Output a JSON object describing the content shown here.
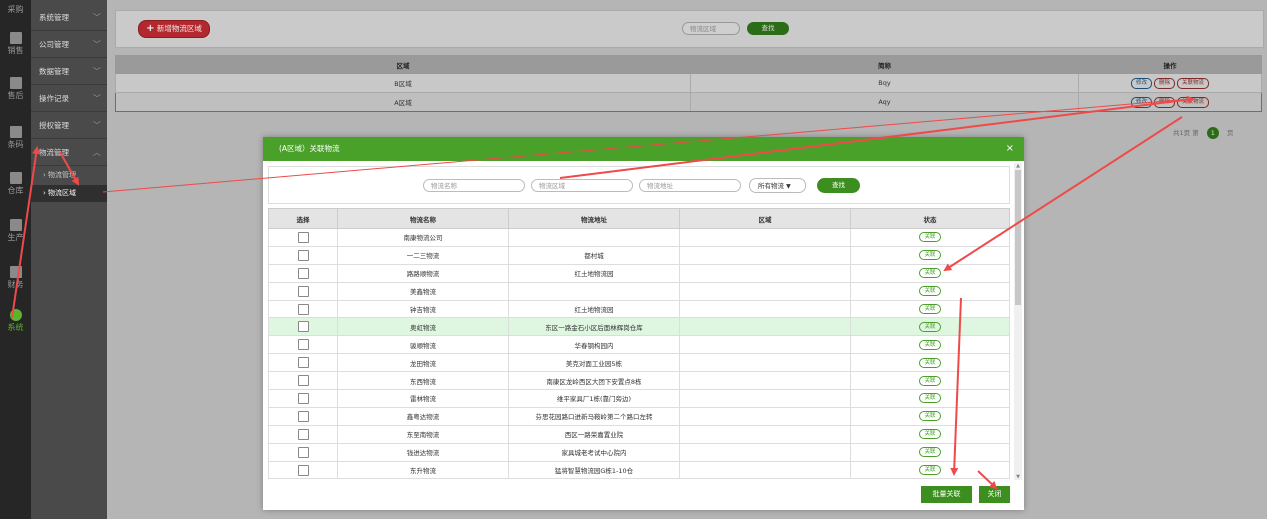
{
  "iconbar": {
    "items": [
      {
        "label": "采购",
        "icon": "purchase-icon"
      },
      {
        "label": "销售",
        "icon": "sales-icon"
      },
      {
        "label": "售后",
        "icon": "aftersale-icon"
      },
      {
        "label": "条码",
        "icon": "barcode-icon"
      },
      {
        "label": "仓库",
        "icon": "warehouse-icon"
      },
      {
        "label": "生产",
        "icon": "production-icon"
      },
      {
        "label": "财务",
        "icon": "finance-icon"
      },
      {
        "label": "系统",
        "icon": "gear-icon"
      }
    ]
  },
  "menu": {
    "items": [
      "系统管理",
      "公司管理",
      "数据管理",
      "操作记录",
      "授权管理",
      "物流管理"
    ],
    "sub_items": [
      "物流管理",
      "物流区域"
    ]
  },
  "toolbar": {
    "add_label": "新增物流区域",
    "search_placeholder": "物流区域",
    "search_label": "查找"
  },
  "main_table": {
    "headers": [
      "区域",
      "简称",
      "操作"
    ],
    "rows": [
      {
        "region": "B区域",
        "abbr": "Bqy"
      },
      {
        "region": "A区域",
        "abbr": "Aqy"
      }
    ],
    "actions": [
      "修改",
      "删除",
      "关联物流"
    ]
  },
  "pager": {
    "text_total": "共1页",
    "text_page": "第",
    "current": "1",
    "text_unit": "页"
  },
  "modal": {
    "title": "(A区域）关联物流",
    "close": "×",
    "filter": {
      "name_placeholder": "物流名称",
      "region_placeholder": "物流区域",
      "address_placeholder": "物流地址",
      "select_value": "所有物流",
      "search_label": "查找"
    },
    "headers": [
      "选择",
      "物流名称",
      "物流地址",
      "区域",
      "状态"
    ],
    "status_label": "关联",
    "rows": [
      {
        "name": "南康物流公司",
        "addr": ""
      },
      {
        "name": "一二三物流",
        "addr": "都村城"
      },
      {
        "name": "路路顺物流",
        "addr": "红土地物流园"
      },
      {
        "name": "美鑫物流",
        "addr": ""
      },
      {
        "name": "钟吉物流",
        "addr": "红土地物流园"
      },
      {
        "name": "奥虹物流",
        "addr": "东区一路金石小区后面林辉岗仓库"
      },
      {
        "name": "骏顺物流",
        "addr": "华春钢构园内"
      },
      {
        "name": "龙田物流",
        "addr": "美克对面工业园5栋"
      },
      {
        "name": "东西物流",
        "addr": "南康区龙岭西区大团下安置点8栋"
      },
      {
        "name": "雷林物流",
        "addr": "维平家具厂1栋(靠门旁边)"
      },
      {
        "name": "鑫粤达物流",
        "addr": "芬思花园路口进新马鞍岭第二个路口左转"
      },
      {
        "name": "东至南物流",
        "addr": "西区一路荣嘉置业院"
      },
      {
        "name": "钱进达物流",
        "addr": "家具城老考试中心院内"
      },
      {
        "name": "东升物流",
        "addr": "猛将智慧物流园G栋1-10仓"
      }
    ],
    "batch_label": "批量关联",
    "close_label": "关闭"
  }
}
